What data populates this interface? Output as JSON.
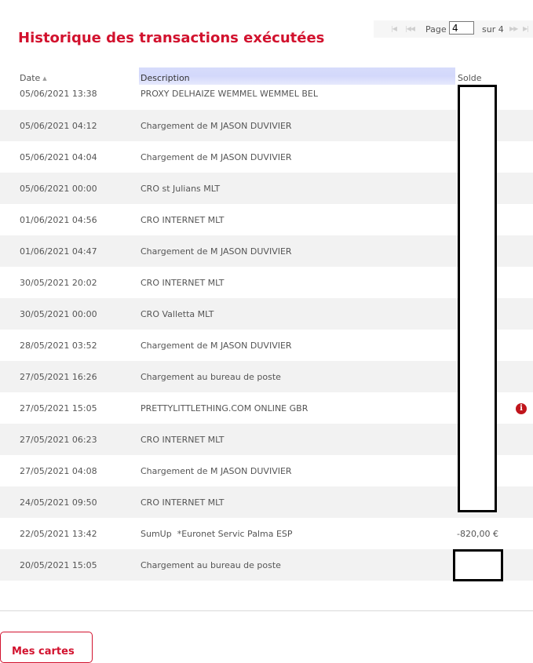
{
  "title": "Historique des transactions exécutées",
  "pager": {
    "page_label": "Page",
    "current_page": "4",
    "of_label": "sur 4",
    "first_icon": "first-page-icon",
    "prev_icon": "prev-page-icon",
    "next_icon": "next-page-icon",
    "last_icon": "last-page-icon"
  },
  "table": {
    "columns": {
      "date": "Date",
      "description": "Description",
      "balance": "Solde"
    },
    "rows": [
      {
        "date": "05/06/2021 13:38",
        "description": "PROXY DELHAIZE WEMMEL WEMMEL BEL",
        "amount": ""
      },
      {
        "date": "05/06/2021 04:12",
        "description": "Chargement de M JASON DUVIVIER",
        "amount": ""
      },
      {
        "date": "05/06/2021 04:04",
        "description": "Chargement de M JASON DUVIVIER",
        "amount": ""
      },
      {
        "date": "05/06/2021 00:00",
        "description": "CRO st Julians MLT",
        "amount": ""
      },
      {
        "date": "01/06/2021 04:56",
        "description": "CRO INTERNET MLT",
        "amount": ""
      },
      {
        "date": "01/06/2021 04:47",
        "description": "Chargement de M JASON DUVIVIER",
        "amount": ""
      },
      {
        "date": "30/05/2021 20:02",
        "description": "CRO INTERNET MLT",
        "amount": ""
      },
      {
        "date": "30/05/2021 00:00",
        "description": "CRO Valletta MLT",
        "amount": ""
      },
      {
        "date": "28/05/2021 03:52",
        "description": "Chargement de M JASON DUVIVIER",
        "amount": ""
      },
      {
        "date": "27/05/2021 16:26",
        "description": "Chargement au bureau de poste",
        "amount": ""
      },
      {
        "date": "27/05/2021 15:05",
        "description": "PRETTYLITTLETHING.COM ONLINE GBR",
        "amount": "",
        "info": "i"
      },
      {
        "date": "27/05/2021 06:23",
        "description": "CRO INTERNET MLT",
        "amount": ""
      },
      {
        "date": "27/05/2021 04:08",
        "description": "Chargement de M JASON DUVIVIER",
        "amount": ""
      },
      {
        "date": "24/05/2021 09:50",
        "description": "CRO INTERNET MLT",
        "amount": ""
      },
      {
        "date": "22/05/2021 13:42",
        "description": "SumUp  *Euronet Servic Palma ESP",
        "amount": "-820,00 €"
      },
      {
        "date": "20/05/2021 15:05",
        "description": "Chargement au bureau de poste",
        "amount": ""
      }
    ]
  },
  "footer": {
    "cards_button": "Mes cartes"
  },
  "colors": {
    "accent": "#d2122e",
    "row_alt": "#f2f2f2",
    "header_highlight": "#d7dcfb"
  }
}
